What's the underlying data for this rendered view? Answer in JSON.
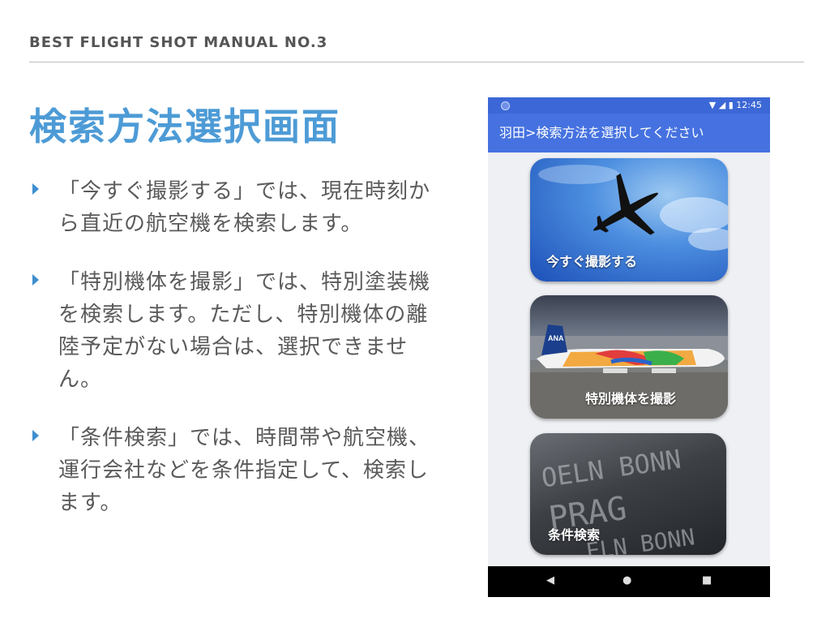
{
  "header": "BEST FLIGHT SHOT MANUAL NO.3",
  "title": "検索方法選択画面",
  "bullets": [
    "「今すぐ撮影する」では、現在時刻から直近の航空機を検索します。",
    "「特別機体を撮影」では、特別塗装機を検索します。ただし、特別機体の離陸予定がない場合は、選択できません。",
    "「条件検索」では、時間帯や航空機、運行会社などを条件指定して、検索します。"
  ],
  "phone": {
    "status_time": "12:45",
    "appbar_title": "羽田>検索方法を選択してください",
    "tiles": [
      {
        "label": "今すぐ撮影する"
      },
      {
        "label": "特別機体を撮影"
      },
      {
        "label": "条件検索"
      }
    ],
    "tile2_tail_logo": "ANA",
    "tile3_board_text": [
      "OELN BONN",
      "PRAG",
      "ELN BONN"
    ]
  }
}
